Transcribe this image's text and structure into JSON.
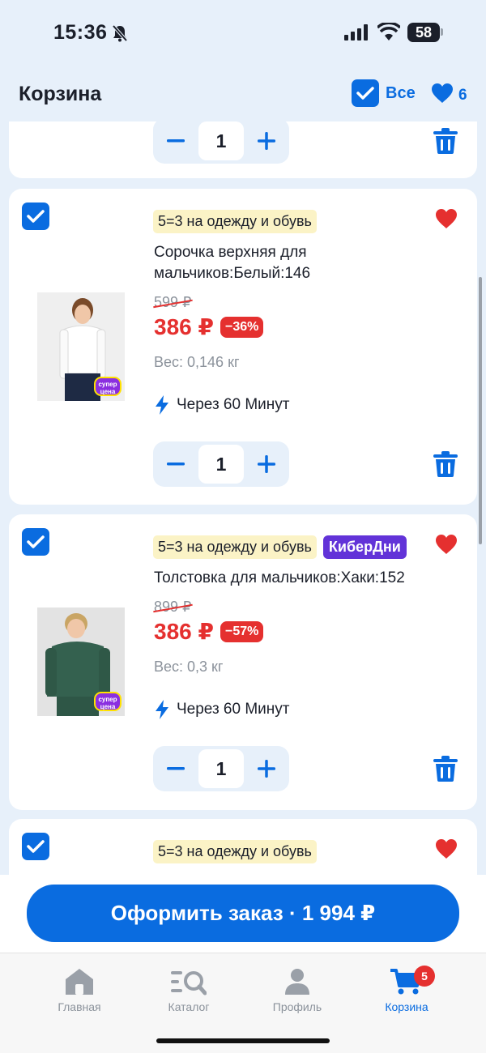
{
  "status_bar": {
    "time": "15:36",
    "battery": "58"
  },
  "header": {
    "title": "Корзина",
    "select_all_label": "Все",
    "favorites_count": "6"
  },
  "items": [
    {
      "promo_badges": [
        "5=3 на одежду и обувь"
      ],
      "name": "Сорочка верхняя для мальчиков:Белый:146",
      "old_price": "599 ₽",
      "price": "386 ₽",
      "discount": "−36%",
      "weight": "Вес: 0,146 кг",
      "delivery": "Через 60 Минут",
      "quantity": "1",
      "super_badge": "супер цена"
    },
    {
      "promo_badges": [
        "5=3 на одежду и обувь",
        "КиберДни"
      ],
      "name": "Толстовка для мальчиков:Хаки:152",
      "old_price": "899 ₽",
      "price": "386 ₽",
      "discount": "−57%",
      "weight": "Вес: 0,3 кг",
      "delivery": "Через 60 Минут",
      "quantity": "1",
      "super_badge": "супер цена"
    },
    {
      "promo_badges": [
        "5=3 на одежду и обувь"
      ]
    }
  ],
  "previous_item": {
    "quantity": "1"
  },
  "checkout": {
    "label": "Оформить заказ · 1 994 ₽"
  },
  "tabs": [
    {
      "label": "Главная"
    },
    {
      "label": "Каталог"
    },
    {
      "label": "Профиль"
    },
    {
      "label": "Корзина",
      "badge": "5"
    }
  ],
  "colors": {
    "accent": "#0a6ce0",
    "sale": "#e5302f",
    "promo_bg": "#fbf3c6",
    "cyber": "#6233d8",
    "background": "#e7f0fa"
  }
}
